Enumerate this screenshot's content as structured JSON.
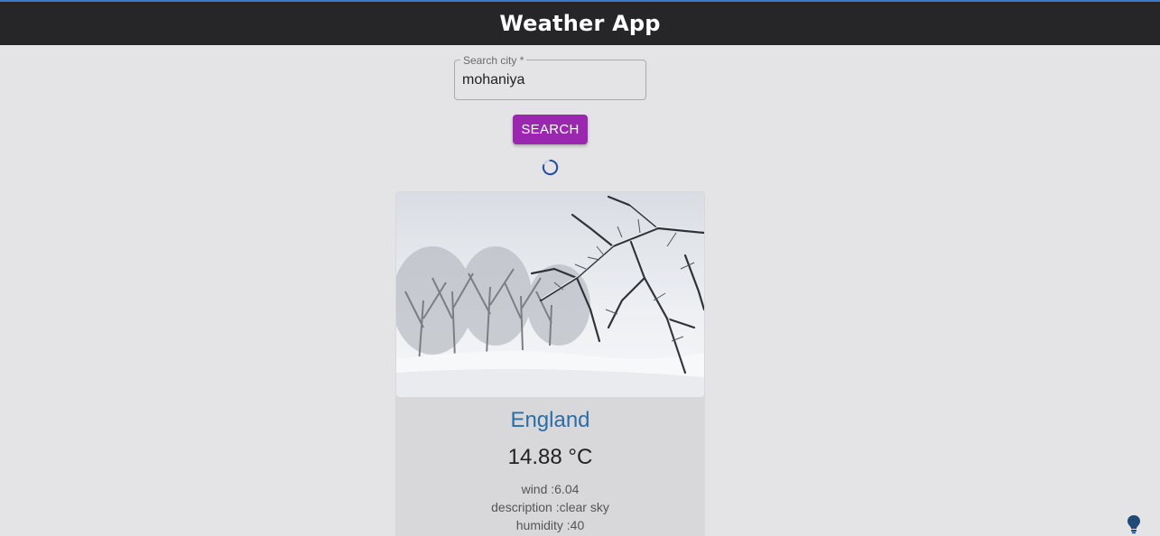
{
  "app": {
    "title": "Weather App"
  },
  "search": {
    "label": "Search city *",
    "value": "mohaniya",
    "button_label": "SEARCH"
  },
  "loading": {
    "icon": "spinner-icon"
  },
  "card": {
    "image_alt": "snow-covered-trees-photo",
    "city": "England",
    "temperature": "14.88 °C",
    "wind": "wind :6.04",
    "description": "description :clear sky",
    "humidity": "humidity :40"
  },
  "colors": {
    "header_bg": "#262628",
    "page_bg": "#e4e4e6",
    "button_bg": "#9b27b0",
    "city_text": "#2a6ea6",
    "spinner": "#2b4f9e",
    "bulb": "#1f4a78"
  },
  "floating": {
    "icon": "lightbulb-icon"
  }
}
